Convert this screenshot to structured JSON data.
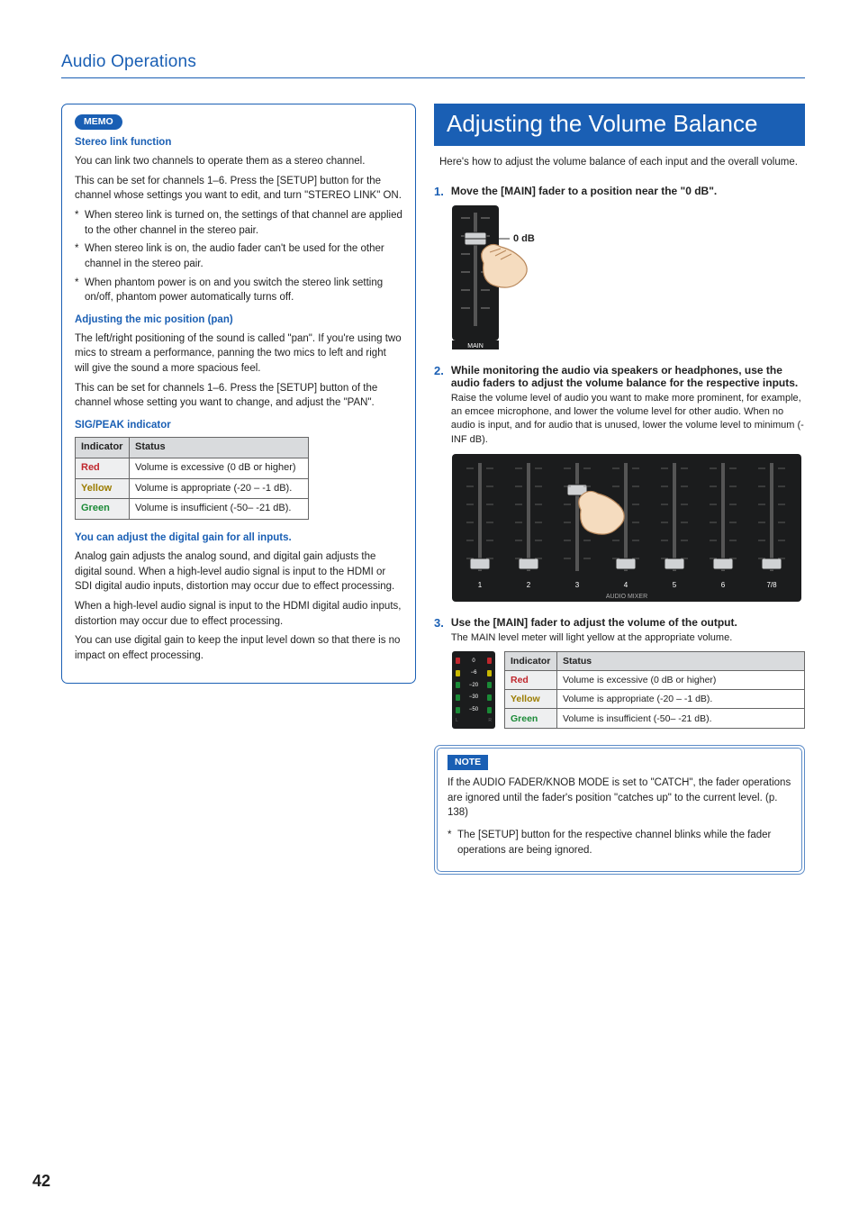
{
  "page_number": "42",
  "chapter_title": "Audio Operations",
  "memo": {
    "badge": "MEMO",
    "stereo_link": {
      "title": "Stereo link function",
      "p1": "You can link two channels to operate them as a stereo channel.",
      "p2": "This can be set for channels 1–6. Press the [SETUP] button for the channel whose settings you want to edit, and turn \"STEREO LINK\" ON.",
      "bullets": [
        "When stereo link is turned on, the settings of that channel are applied to the other channel in the stereo pair.",
        "When stereo link is on, the audio fader can't be used for the other channel in the stereo pair.",
        "When phantom power is on and you switch the stereo link setting on/off, phantom power automatically turns off."
      ]
    },
    "pan": {
      "title": "Adjusting the mic position (pan)",
      "p1": "The left/right positioning of the sound is called \"pan\". If you're using two mics to stream a performance, panning the two mics to left and right will give the sound a more spacious feel.",
      "p2": "This can be set for channels 1–6. Press the [SETUP] button of the channel whose setting you want to change, and adjust the \"PAN\"."
    },
    "sig": {
      "title": "SIG/PEAK indicator",
      "headers": [
        "Indicator",
        "Status"
      ],
      "rows": [
        {
          "ind": "Red",
          "cls": "red-text",
          "status": "Volume is excessive (0 dB or higher)"
        },
        {
          "ind": "Yellow",
          "cls": "yellow-text",
          "status": "Volume is appropriate (-20 – -1 dB)."
        },
        {
          "ind": "Green",
          "cls": "green-text",
          "status": "Volume is insufficient (-50– -21 dB)."
        }
      ]
    },
    "dgain": {
      "title": "You can adjust the digital gain for all inputs.",
      "p1": "Analog gain adjusts the analog sound, and digital gain adjusts the digital sound. When a high-level audio signal is input to the HDMI or SDI digital audio inputs, distortion may occur due to effect processing.",
      "p2": "When a high-level audio signal is input to the HDMI digital audio inputs, distortion may occur due to effect processing.",
      "p3": "You can use digital gain to keep the input level down so that there is no impact on effect processing."
    }
  },
  "right": {
    "banner": "Adjusting the Volume Balance",
    "intro": "Here's how to adjust the volume balance of each input and the overall volume.",
    "step1": {
      "num": "1.",
      "text": "Move the [MAIN] fader to a position near the \"0 dB\".",
      "label_0db": "0 dB",
      "label_main": "MAIN"
    },
    "step2": {
      "num": "2.",
      "text": "While monitoring the audio via speakers or headphones, use the audio faders to adjust the volume balance for the respective inputs.",
      "sub": "Raise the volume level of audio you want to make more prominent, for example, an emcee microphone, and lower the volume level for other audio. When no audio is input, and for audio that is unused, lower the volume level to minimum (-INF dB).",
      "labels": [
        "1",
        "2",
        "3",
        "4",
        "5",
        "6",
        "7/8"
      ],
      "mixer_label": "AUDIO MIXER"
    },
    "step3": {
      "num": "3.",
      "text": "Use the [MAIN] fader to adjust the volume of the output.",
      "sub": "The MAIN level meter will light yellow at the appropriate volume.",
      "meter_labels": [
        "0",
        "−6",
        "−20",
        "−30",
        "−50"
      ],
      "meter_foot": [
        "L",
        "R"
      ],
      "headers": [
        "Indicator",
        "Status"
      ],
      "rows": [
        {
          "ind": "Red",
          "cls": "red-text",
          "status": "Volume is excessive (0 dB or higher)"
        },
        {
          "ind": "Yellow",
          "cls": "yellow-text",
          "status": "Volume is appropriate (-20 – -1 dB)."
        },
        {
          "ind": "Green",
          "cls": "green-text",
          "status": "Volume is insufficient (-50– -21 dB)."
        }
      ]
    },
    "note": {
      "badge": "NOTE",
      "p1": "If the AUDIO FADER/KNOB MODE is set to \"CATCH\", the fader operations are ignored until the fader's position \"catches up\" to the current level. (p. 138)",
      "bullet": "The [SETUP] button for the respective channel blinks while the fader operations are being ignored."
    }
  }
}
